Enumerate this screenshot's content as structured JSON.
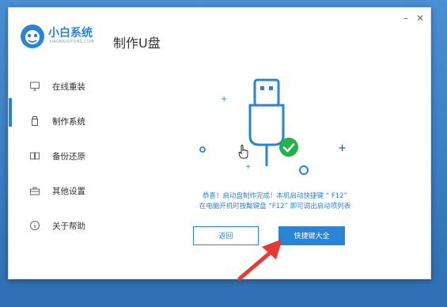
{
  "app": {
    "brand": "小白系统",
    "brand_sub": "XIAOBAIXITONG.COM",
    "page_title": "制作U盘",
    "accent": "#2a84d6"
  },
  "window_controls": {
    "minimize_icon": "minimize-icon",
    "close_icon": "close-icon"
  },
  "sidebar": {
    "items": [
      {
        "label": "在线重装",
        "icon": "monitor-icon"
      },
      {
        "label": "制作系统",
        "icon": "usb-icon",
        "active": true
      },
      {
        "label": "备份还原",
        "icon": "backup-icon"
      },
      {
        "label": "其他设置",
        "icon": "toolbox-icon"
      },
      {
        "label": "关于帮助",
        "icon": "info-icon"
      }
    ]
  },
  "main": {
    "message_line1": "恭喜！启动盘制作完成！本机启动快捷键 “ F12”",
    "message_line2": "在电脑开机时按黝键盘 “F12” 即可调出启动项列表",
    "back_button": "返回",
    "hotkeys_button": "快捷键大全",
    "success_color": "#21b24b"
  }
}
